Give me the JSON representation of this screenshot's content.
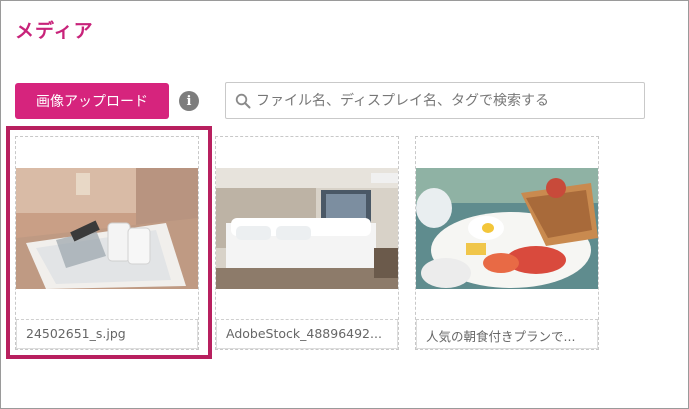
{
  "media": {
    "title": "メディア",
    "upload_label": "画像アップロード",
    "info_icon": "info-icon",
    "search": {
      "placeholder": "ファイル名、ディスプレイ名、タグで検索する",
      "icon": "search-icon"
    },
    "items": [
      {
        "filename": "24502651_s.jpg",
        "selected": true
      },
      {
        "filename": "AdobeStock_48896492..."
      },
      {
        "filename": "人気の朝食付きプランで..."
      }
    ],
    "colors": {
      "accent": "#d6247d",
      "title": "#c8237a",
      "selection_border": "#b8205f"
    }
  }
}
